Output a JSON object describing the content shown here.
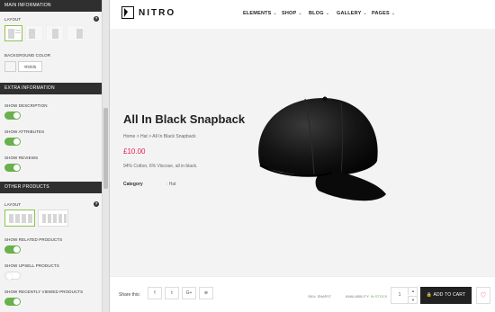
{
  "panel": {
    "main_section": "MAIN INFORMATION",
    "layout_label": "LAYOUT",
    "help_glyph": "?",
    "bg_color_label": "BACKGROUND COLOR",
    "bg_color_value": "#f5f5f5",
    "extra_section": "EXTRA INFORMATION",
    "show_description": "SHOW DESCRIPTION",
    "show_attributes": "SHOW ATTRIBUTES",
    "show_reviews": "SHOW REVIEWS",
    "other_section": "OTHER PRODUCTS",
    "layout_label2": "LAYOUT",
    "show_related": "SHOW RELATED PRODUCTS",
    "show_upsell": "SHOW UPSELL PRODUCTS",
    "show_recent": "SHOW RECENTLY VIEWED PRODUCTS",
    "toggles": {
      "description": true,
      "attributes": true,
      "reviews": true,
      "related": true,
      "upsell": false,
      "recent": true
    },
    "accent_color": "#6ab04c"
  },
  "site": {
    "logo": "NITRO",
    "nav": [
      {
        "label": "ELEMENTS"
      },
      {
        "label": "SHOP"
      },
      {
        "label": "BLOG"
      },
      {
        "label": "GALLERY"
      },
      {
        "label": "PAGES"
      }
    ],
    "caret": "⌄",
    "product": {
      "title": "All In Black Snapback",
      "breadcrumb": "Home > Hat > All In Black Snapback",
      "price": "£10.00",
      "description": "94% Cotton, 6% Viscose, all in black.",
      "category_label": "Category",
      "category_value": ": Hat"
    },
    "footer": {
      "share_label": "Share this:",
      "share_icons": [
        "f",
        "𝕥",
        "G+",
        "⊕"
      ],
      "sku": "SKU:  SNAP07",
      "availability_label": "AVAILABILITY:",
      "availability_value": "IN STOCK",
      "qty": "1",
      "qty_up": "▲",
      "qty_down": "▼",
      "add_to_cart": "🔒 ADD TO CART",
      "wishlist_icon": "♡"
    },
    "price_color": "#e91e4a"
  }
}
